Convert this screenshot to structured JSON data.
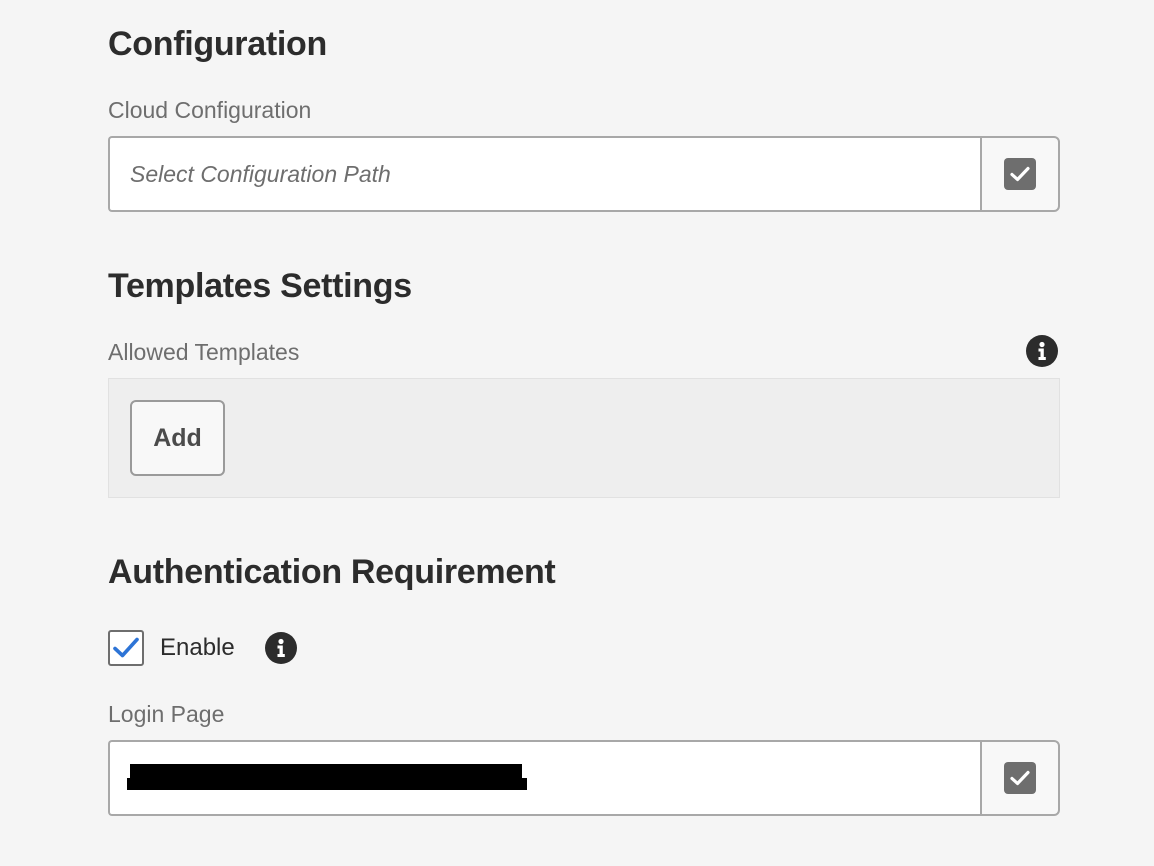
{
  "configuration": {
    "heading": "Configuration",
    "cloud_label": "Cloud Configuration",
    "cloud_placeholder": "Select Configuration Path",
    "cloud_value": ""
  },
  "templates": {
    "heading": "Templates Settings",
    "allowed_label": "Allowed Templates",
    "add_label": "Add"
  },
  "authentication": {
    "heading": "Authentication Requirement",
    "enable_label": "Enable",
    "enable_checked": true,
    "login_label": "Login Page",
    "login_value": ""
  },
  "colors": {
    "background": "#f5f5f5",
    "checkmark": "#2d74d6",
    "icon_gray": "#6e6e6e",
    "redaction": "#000000"
  },
  "icons": [
    "check-icon",
    "info-icon",
    "checkbox-check-icon"
  ]
}
